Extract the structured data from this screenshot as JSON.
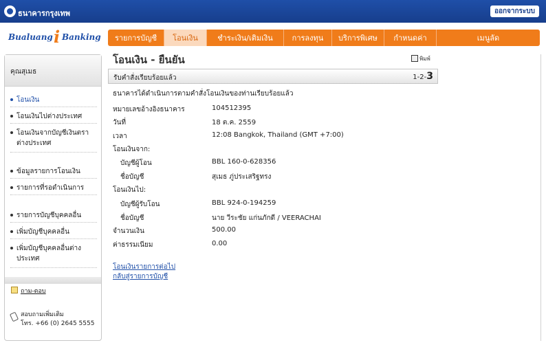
{
  "header": {
    "bank_name": "ธนาคารกรุงเทพ",
    "logout_label": "ออกจากระบบ"
  },
  "brand": {
    "part_a": "Bualuang",
    "part_i": "i",
    "part_b": "Banking"
  },
  "nav": {
    "tabs": [
      {
        "label": "รายการบัญชี",
        "active": false
      },
      {
        "label": "โอนเงิน",
        "active": true
      },
      {
        "label": "ชำระเงิน/เติมเงิน",
        "active": false
      },
      {
        "label": "การลงทุน",
        "active": false
      },
      {
        "label": "บริการพิเศษ",
        "active": false
      },
      {
        "label": "กำหนดค่า",
        "active": false
      },
      {
        "label": "เมนูลัด",
        "active": false
      }
    ]
  },
  "sidebar": {
    "user_label": "คุณสุเมธ",
    "items": [
      {
        "label": "โอนเงิน",
        "active": true
      },
      {
        "label": "โอนเงินไปต่างประเทศ",
        "active": false
      },
      {
        "label": "โอนเงินจากบัญชีเงินตราต่างประเทศ",
        "active": false
      },
      {
        "label": "ข้อมูลรายการโอนเงิน",
        "active": false
      },
      {
        "label": "รายการที่รอดำเนินการ",
        "active": false
      },
      {
        "label": "รายการบัญชีบุคคลอื่น",
        "active": false
      },
      {
        "label": "เพิ่มบัญชีบุคคลอื่น",
        "active": false
      },
      {
        "label": "เพิ่มบัญชีบุคคลอื่นต่างประเทศ",
        "active": false
      }
    ],
    "faq_label": "ถาม-ตอบ",
    "contact_line1": "สอบถามเพิ่มเติม",
    "contact_line2": "โทร. +66 (0) 2645 5555"
  },
  "main": {
    "title": "โอนเงิน - ยืนยัน",
    "print_label": "พิมพ์",
    "status": "รับคำสั่งเรียบร้อยแล้ว",
    "step_prefix": "1-2-",
    "step_current": "3",
    "message": "ธนาคารได้ดำเนินการตามคำสั่งโอนเงินของท่านเรียบร้อยแล้ว",
    "rows": [
      {
        "label": "หมายเลขอ้างอิงธนาคาร",
        "value": "104512395"
      },
      {
        "label": "วันที่",
        "value": "18 ต.ค. 2559"
      },
      {
        "label": "เวลา",
        "value": "12:08 Bangkok, Thailand (GMT +7:00)"
      }
    ],
    "from_section": "โอนเงินจาก:",
    "from_rows": [
      {
        "label": "บัญชีผู้โอน",
        "value": "BBL 160-0-628356"
      },
      {
        "label": "ชื่อบัญชี",
        "value": "สุเมธ ภู่ประเสริฐทรง"
      }
    ],
    "to_section": "โอนเงินไป:",
    "to_rows": [
      {
        "label": "บัญชีผู้รับโอน",
        "value": "BBL 924-0-194259"
      },
      {
        "label": "ชื่อบัญชี",
        "value": "นาย วีระชัย แก่นภักดี / VEERACHAI"
      }
    ],
    "amount_label": "จำนวนเงิน",
    "amount_value": "500.00",
    "fee_label": "ค่าธรรมเนียม",
    "fee_value": "0.00",
    "link_next": "โอนเงินรายการต่อไป",
    "link_back": "กลับสู่รายการบัญชี"
  }
}
